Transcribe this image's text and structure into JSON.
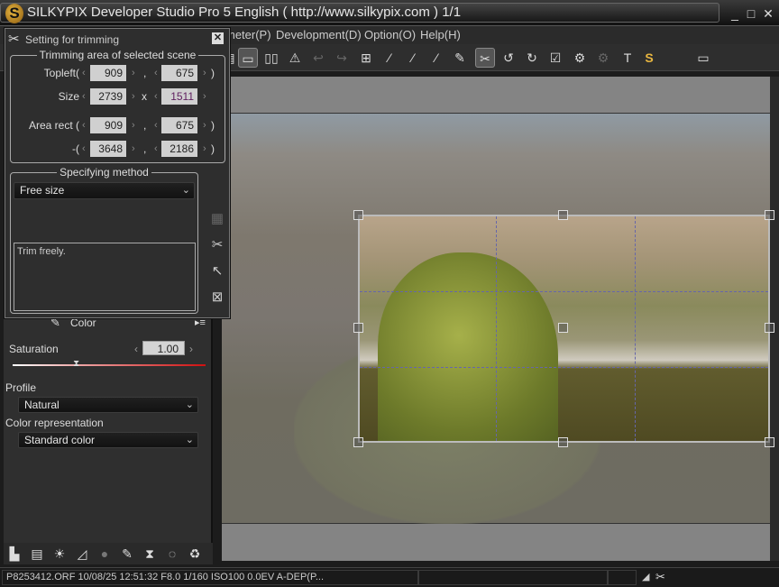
{
  "window": {
    "title": "SILKYPIX Developer Studio Pro 5 English ( http://www.silkypix.com )   1/1",
    "logo": "S",
    "controls": {
      "minimize": "_",
      "maximize": "□",
      "close": "✕"
    }
  },
  "menu": [
    {
      "label": "meter(P)"
    },
    {
      "label": "Development(D)"
    },
    {
      "label": "Option(O)"
    },
    {
      "label": "Help(H)"
    }
  ],
  "toolbar": [
    {
      "name": "layout-icon",
      "glyph": "▤"
    },
    {
      "name": "single-view-icon",
      "glyph": "▭",
      "active": true
    },
    {
      "name": "compare-view-icon",
      "glyph": "▯▯"
    },
    {
      "name": "warning-icon",
      "glyph": "⚠"
    },
    {
      "name": "undo-icon",
      "glyph": "↩",
      "disabled": true
    },
    {
      "name": "redo-icon",
      "glyph": "↪",
      "disabled": true
    },
    {
      "name": "fit-icon",
      "glyph": "⊞"
    },
    {
      "name": "white-balance-picker-icon",
      "glyph": "⁄"
    },
    {
      "name": "gray-picker-icon",
      "glyph": "⁄"
    },
    {
      "name": "black-picker-icon",
      "glyph": "⁄"
    },
    {
      "name": "brush-icon",
      "glyph": "✎"
    },
    {
      "name": "trimming-icon",
      "glyph": "✂",
      "active": true
    },
    {
      "name": "rotate-left-icon",
      "glyph": "↺"
    },
    {
      "name": "rotate-right-icon",
      "glyph": "↻"
    },
    {
      "name": "check-icon",
      "glyph": "☑"
    },
    {
      "name": "save-settings-icon",
      "glyph": "⚙"
    },
    {
      "name": "apply-settings-icon",
      "glyph": "⚙",
      "disabled": true
    },
    {
      "name": "hammer-icon",
      "glyph": "T"
    },
    {
      "name": "silkypix-icon",
      "glyph": "S"
    },
    {
      "name": "monitor-icon",
      "glyph": "▭"
    }
  ],
  "dialog": {
    "title": "Setting for trimming",
    "close": "✕",
    "area_group": {
      "title": "Trimming area of selected scene",
      "topleft_label": "Topleft(",
      "topleft_x": "909",
      "topleft_y": "675",
      "size_label": "Size",
      "size_w": "2739",
      "size_sep": "x",
      "size_h": "1511",
      "area_rect_label": "Area rect (",
      "rect_x1": "909",
      "rect_y1": "675",
      "rect_end_label": "-(",
      "rect_x2": "3648",
      "rect_y2": "2186",
      "comma": ",",
      "close_paren": ")"
    },
    "method_group": {
      "title": "Specifying method",
      "selected": "Free size",
      "description": "Trim freely."
    },
    "side_icons": [
      {
        "name": "aspect-guide-icon",
        "glyph": "▦"
      },
      {
        "name": "trim-reset-icon",
        "glyph": "✂"
      },
      {
        "name": "select-trim-icon",
        "glyph": "↖"
      },
      {
        "name": "fit-frame-icon",
        "glyph": "⊠"
      }
    ]
  },
  "color_panel": {
    "header": "Color",
    "saturation_label": "Saturation",
    "saturation_value": "1.00",
    "saturation_fraction": 0.33,
    "profile_label": "Profile",
    "profile_value": "Natural",
    "color_rep_label": "Color representation",
    "color_rep_value": "Standard color"
  },
  "bottom_tools": [
    {
      "name": "histogram-icon",
      "glyph": "▙"
    },
    {
      "name": "comment-icon",
      "glyph": "▤"
    },
    {
      "name": "exposure-icon",
      "glyph": "☀"
    },
    {
      "name": "tone-curve-icon",
      "glyph": "◿"
    },
    {
      "name": "color-ball-icon",
      "glyph": "●"
    },
    {
      "name": "sharpness-icon",
      "glyph": "✎"
    },
    {
      "name": "lens-icon",
      "glyph": "⧗"
    },
    {
      "name": "rotation-icon",
      "glyph": "◌"
    },
    {
      "name": "recycle-icon",
      "glyph": "♻"
    }
  ],
  "status": {
    "file_info": "P8253412.ORF 10/08/25 12:51:32 F8.0 1/160 ISO100  0.0EV A-DEP(P...",
    "icon1": "◢",
    "icon2": "✂"
  }
}
